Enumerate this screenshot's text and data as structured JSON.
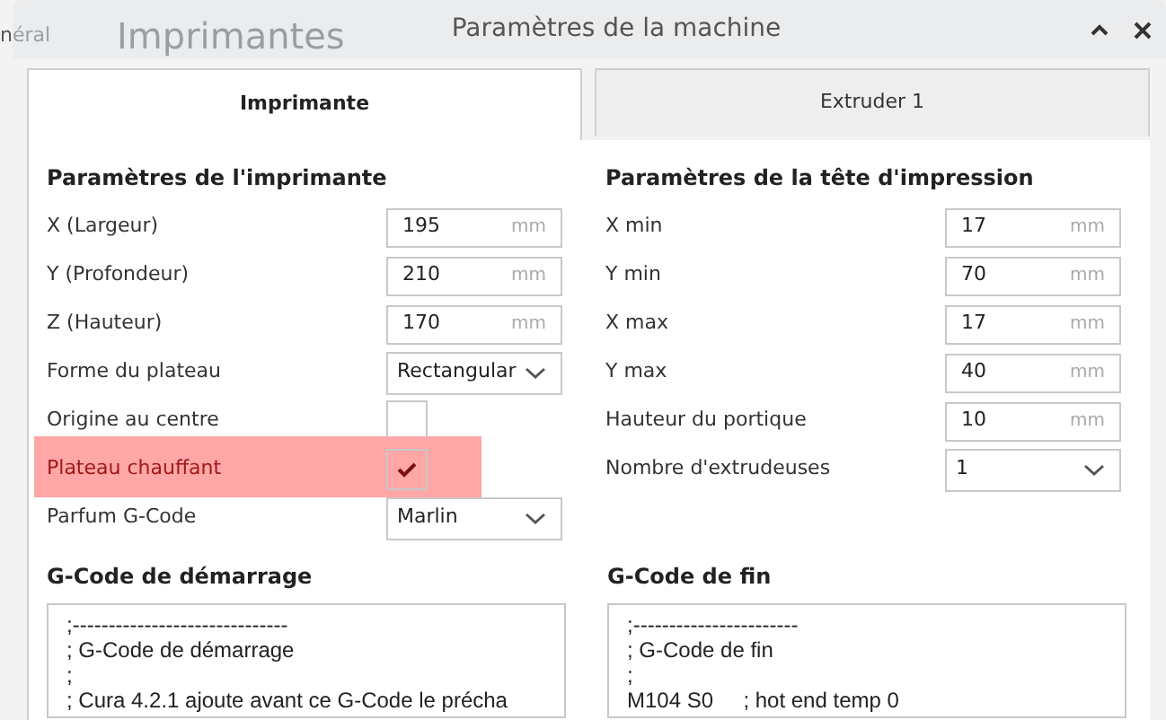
{
  "background_window": {
    "tab": "néral",
    "title": "Imprimantes"
  },
  "window": {
    "title": "Paramètres de la machine"
  },
  "tabs": [
    {
      "label": "Imprimante",
      "selected": true
    },
    {
      "label": "Extruder 1",
      "selected": false
    }
  ],
  "printer_settings": {
    "heading": "Paramètres de l'imprimante",
    "fields": [
      {
        "kind": "number",
        "label": "X (Largeur)",
        "value": "195",
        "unit": "mm"
      },
      {
        "kind": "number",
        "label": "Y (Profondeur)",
        "value": "210",
        "unit": "mm"
      },
      {
        "kind": "number",
        "label": "Z (Hauteur)",
        "value": "170",
        "unit": "mm"
      },
      {
        "kind": "select",
        "label": "Forme du plateau",
        "value": "Rectangular"
      },
      {
        "kind": "checkbox",
        "label": "Origine au centre",
        "checked": false,
        "highlighted": false
      },
      {
        "kind": "checkbox",
        "label": "Plateau chauffant",
        "checked": true,
        "highlighted": true
      },
      {
        "kind": "select",
        "label": "Parfum G-Code",
        "value": "Marlin"
      }
    ]
  },
  "printhead_settings": {
    "heading": "Paramètres de la tête d'impression",
    "fields": [
      {
        "kind": "number",
        "label": "X min",
        "value": "17",
        "unit": "mm"
      },
      {
        "kind": "number",
        "label": "Y min",
        "value": "70",
        "unit": "mm"
      },
      {
        "kind": "number",
        "label": "X max",
        "value": "17",
        "unit": "mm"
      },
      {
        "kind": "number",
        "label": "Y max",
        "value": "40",
        "unit": "mm"
      },
      {
        "kind": "number",
        "label": "Hauteur du portique",
        "value": "10",
        "unit": "mm"
      },
      {
        "kind": "select",
        "label": "Nombre d'extrudeuses",
        "value": "1"
      }
    ]
  },
  "start_gcode": {
    "heading": "G-Code de démarrage",
    "lines": [
      ";------------------------------",
      "; G-Code de démarrage",
      ";",
      "; Cura 4.2.1 ajoute avant ce G-Code le précha"
    ]
  },
  "end_gcode": {
    "heading": "G-Code de fin",
    "lines": [
      ";-----------------------",
      "; G-Code de fin",
      ";",
      "M104 S0     ; hot end temp 0"
    ]
  }
}
